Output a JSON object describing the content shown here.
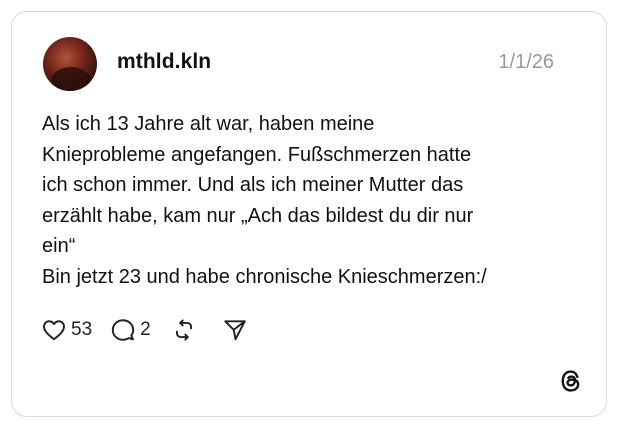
{
  "post": {
    "username": "mthld.kln",
    "date": "1/1/26",
    "text": "Als ich 13 Jahre alt war, haben meine\nKnieprobleme angefangen. Fußschmerzen hatte\nich schon immer. Und als ich meiner Mutter das\nerzählt habe, kam nur „Ach das bildest du dir nur\nein“\nBin jetzt 23 und habe chronische Knieschmerzen:/",
    "likes": "53",
    "replies": "2"
  },
  "icons": {
    "like": "heart-icon",
    "reply": "speech-bubble-icon",
    "repost": "repost-icon",
    "share": "send-icon",
    "brand": "threads-logo-icon"
  },
  "colors": {
    "card_border": "#d9d9d9",
    "date": "#9a9a9a",
    "text": "#111111"
  }
}
